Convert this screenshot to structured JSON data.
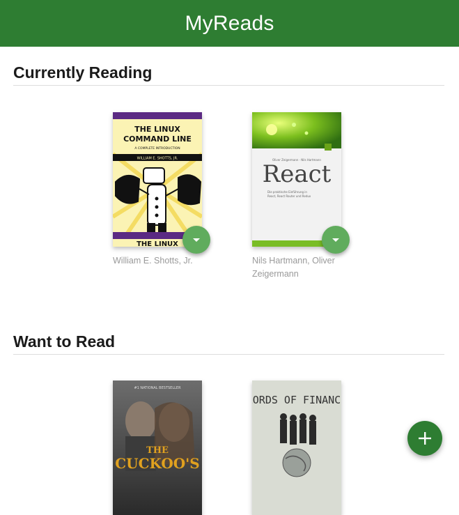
{
  "app": {
    "title": "MyReads"
  },
  "shelves": [
    {
      "title": "Currently Reading",
      "books": [
        {
          "cover": {
            "headline": "THE LINUX COMMAND LINE",
            "subline": "A COMPLETE INTRODUCTION",
            "author_line": "WILLIAM E. SHOTTS, JR.",
            "footer": "THE LINUX"
          },
          "authors": "William E. Shotts, Jr."
        },
        {
          "cover": {
            "topline": "Oliver Zeigermann · Nils Hartmann",
            "headline": "React",
            "subline": "Die praktische Einführung in React, React Router und Redux"
          },
          "authors": "Nils Hartmann, Oliver Zeigermann"
        }
      ]
    },
    {
      "title": "Want to Read",
      "books": [
        {
          "cover": {
            "topline": "#1 NATIONAL BESTSELLER",
            "headline": "THE CUCKOO'S"
          }
        },
        {
          "cover": {
            "headline": "LORDS OF FINANCE"
          }
        }
      ]
    }
  ],
  "colors": {
    "header": "#2e7d32",
    "shelf_changer": "#60ac5d",
    "add_button": "#2e7d32",
    "author_text": "#999999"
  },
  "icons": {
    "shelf_changer": "triangle-down-icon",
    "add": "plus-icon"
  }
}
